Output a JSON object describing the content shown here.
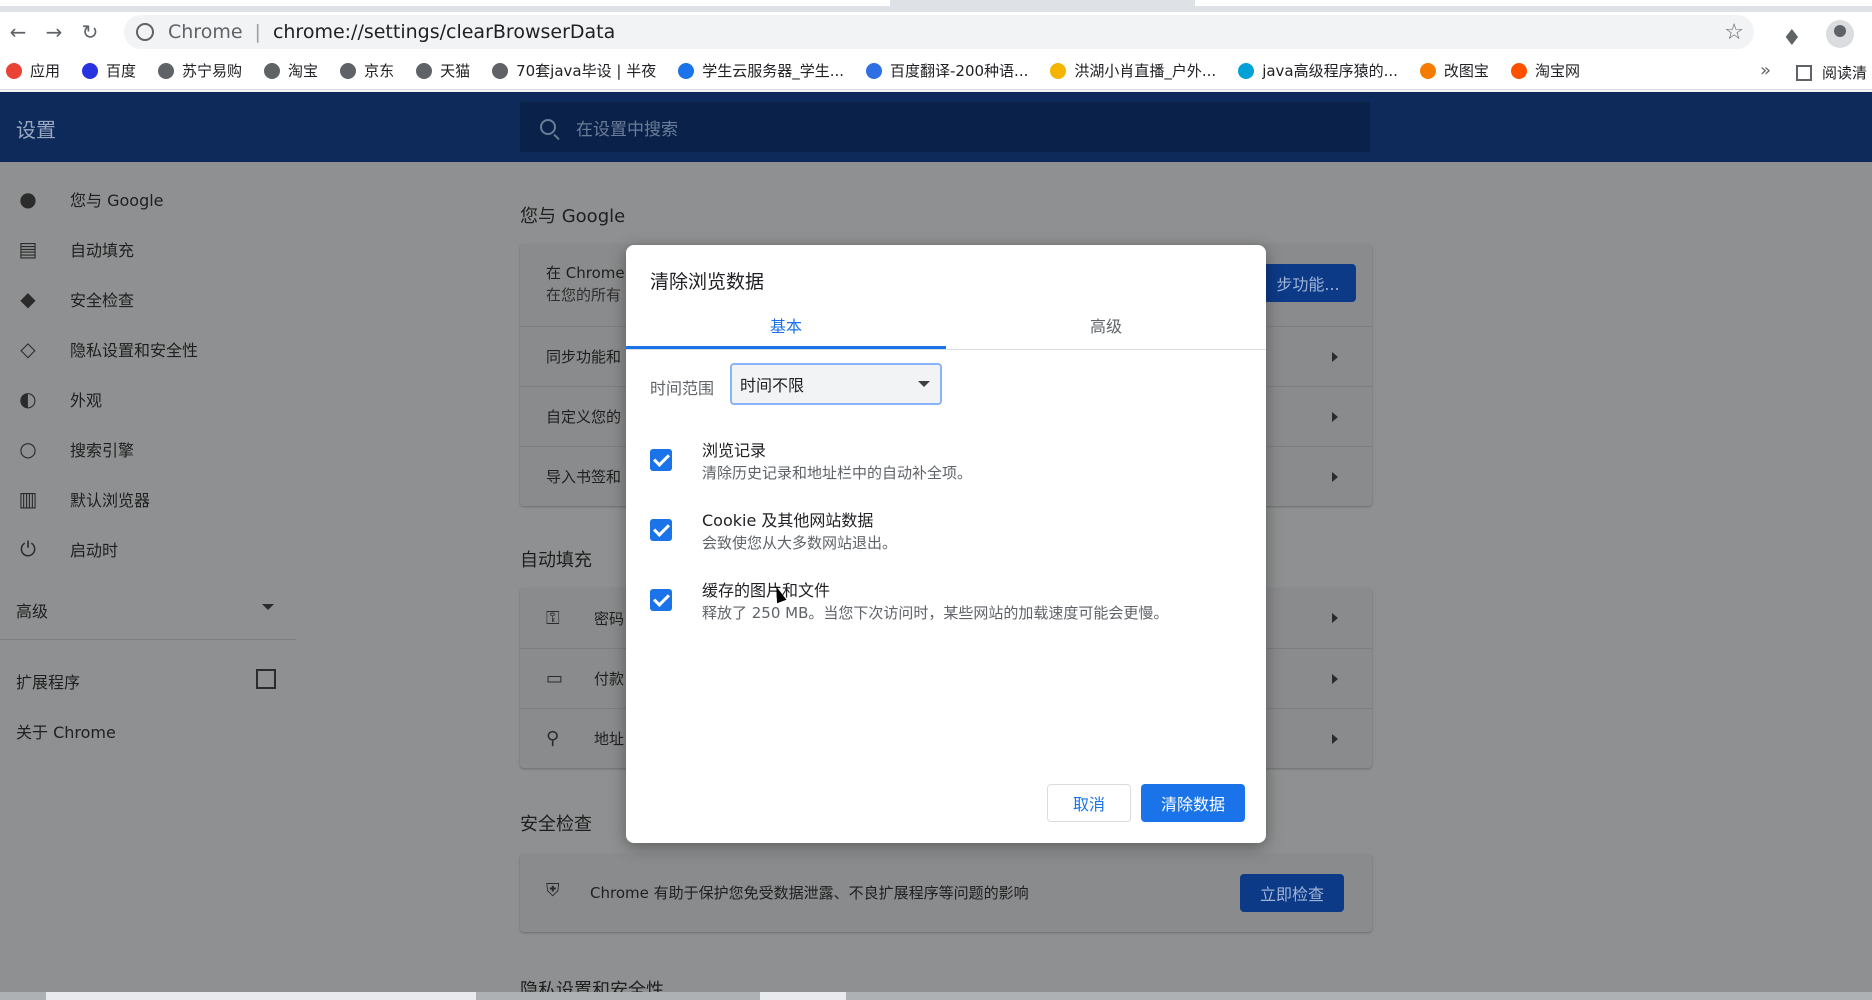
{
  "browser": {
    "omnibox": {
      "scheme": "Chrome",
      "url": "chrome://settings/clearBrowserData"
    },
    "bookmarks": [
      {
        "label": "应用",
        "icon": "apps-grid-icon",
        "color": "#ea4335"
      },
      {
        "label": "百度",
        "icon": "baidu-paw-icon",
        "color": "#2932e1"
      },
      {
        "label": "苏宁易购",
        "icon": "globe-icon",
        "color": "#5f6368"
      },
      {
        "label": "淘宝",
        "icon": "globe-icon",
        "color": "#5f6368"
      },
      {
        "label": "京东",
        "icon": "globe-icon",
        "color": "#5f6368"
      },
      {
        "label": "天猫",
        "icon": "globe-icon",
        "color": "#5f6368"
      },
      {
        "label": "70套java毕设 | 半夜",
        "icon": "globe-icon",
        "color": "#5f6368"
      },
      {
        "label": "学生云服务器_学生...",
        "icon": "cloud-icon",
        "color": "#1a73e8"
      },
      {
        "label": "百度翻译-200种语...",
        "icon": "translate-icon",
        "color": "#2f6fe4"
      },
      {
        "label": "洪湖小肖直播_户外...",
        "icon": "bee-icon",
        "color": "#f4b400"
      },
      {
        "label": "java高级程序猿的...",
        "icon": "bilibili-icon",
        "color": "#00a1d6"
      },
      {
        "label": "改图宝",
        "icon": "orange-square-icon",
        "color": "#f57c00"
      },
      {
        "label": "淘宝网",
        "icon": "taobao-icon",
        "color": "#ff5000"
      }
    ],
    "reader_label": "阅读清"
  },
  "settings": {
    "title": "设置",
    "search_placeholder": "在设置中搜索",
    "nav": [
      {
        "label": "您与 Google",
        "icon": "person-icon"
      },
      {
        "label": "自动填充",
        "icon": "clipboard-icon"
      },
      {
        "label": "安全检查",
        "icon": "shield-check-icon"
      },
      {
        "label": "隐私设置和安全性",
        "icon": "shield-icon"
      },
      {
        "label": "外观",
        "icon": "palette-icon"
      },
      {
        "label": "搜索引擎",
        "icon": "search-icon"
      },
      {
        "label": "默认浏览器",
        "icon": "browser-icon"
      },
      {
        "label": "启动时",
        "icon": "power-icon"
      }
    ],
    "nav_advanced": "高级",
    "nav_extensions": "扩展程序",
    "nav_about": "关于 Chrome",
    "sections": {
      "you_and_google": "您与 Google",
      "sync_card_line1": "在 Chrome",
      "sync_card_line2": "在您的所有",
      "sync_button": "步功能...",
      "rows": [
        "同步功能和",
        "自定义您的",
        "导入书签和"
      ],
      "autofill": "自动填充",
      "autofill_rows": [
        "密码",
        "付款",
        "地址"
      ],
      "safety_check": "安全检查",
      "safety_text": "Chrome 有助于保护您免受数据泄露、不良扩展程序等问题的影响",
      "safety_button": "立即检查",
      "privacy": "隐私设置和安全性"
    }
  },
  "dialog": {
    "title": "清除浏览数据",
    "tabs": [
      "基本",
      "高级"
    ],
    "active_tab": "基本",
    "time_range_label": "时间范围",
    "time_range_value": "时间不限",
    "options": [
      {
        "title": "浏览记录",
        "desc": "清除历史记录和地址栏中的自动补全项。",
        "checked": true
      },
      {
        "title": "Cookie 及其他网站数据",
        "desc": "会致使您从大多数网站退出。",
        "checked": true
      },
      {
        "title": "缓存的图片和文件",
        "desc": "释放了 250 MB。当您下次访问时，某些网站的加载速度可能会更慢。",
        "checked": true
      }
    ],
    "cancel_label": "取消",
    "confirm_label": "清除数据"
  },
  "colors": {
    "accent": "#1a73e8",
    "header": "#0d2a5b"
  }
}
